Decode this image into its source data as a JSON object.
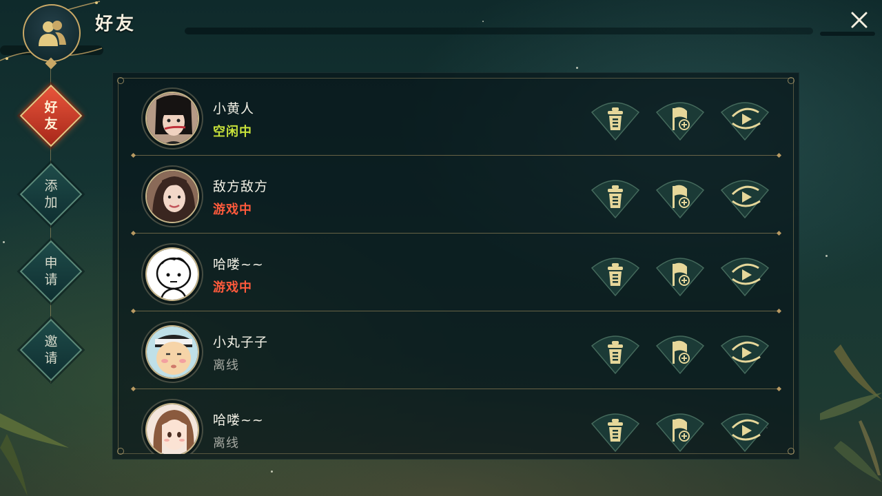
{
  "header": {
    "title": "好友"
  },
  "nav": [
    {
      "label_line1": "好",
      "label_line2": "友",
      "active": true
    },
    {
      "label_line1": "添",
      "label_line2": "加",
      "active": false
    },
    {
      "label_line1": "申",
      "label_line2": "请",
      "active": false
    },
    {
      "label_line1": "邀",
      "label_line2": "请",
      "active": false
    }
  ],
  "friends": [
    {
      "name": "小黄人",
      "status": "空闲中",
      "status_color": "#c8e23a",
      "avatar_icon": "woman-avatar-icon"
    },
    {
      "name": "敌方敌方",
      "status": "游戏中",
      "status_color": "#ff5a3c",
      "avatar_icon": "woman-photo-avatar-icon"
    },
    {
      "name": "哈喽~~",
      "status": "游戏中",
      "status_color": "#ff5a3c",
      "avatar_icon": "cartoon-face-avatar-icon"
    },
    {
      "name": "小丸子子",
      "status": "离线",
      "status_color": "#a7aaa3",
      "avatar_icon": "cartoon-man-avatar-icon"
    },
    {
      "name": "哈喽~~",
      "status": "离线",
      "status_color": "#a7aaa3",
      "avatar_icon": "cartoon-girl-avatar-icon"
    }
  ],
  "actions": [
    "delete-icon",
    "flag-add-icon",
    "invite-play-icon"
  ],
  "colors": {
    "gold": "#e6d79a",
    "accent_red": "#c8341f",
    "panel_bg": "#0b1c20"
  }
}
